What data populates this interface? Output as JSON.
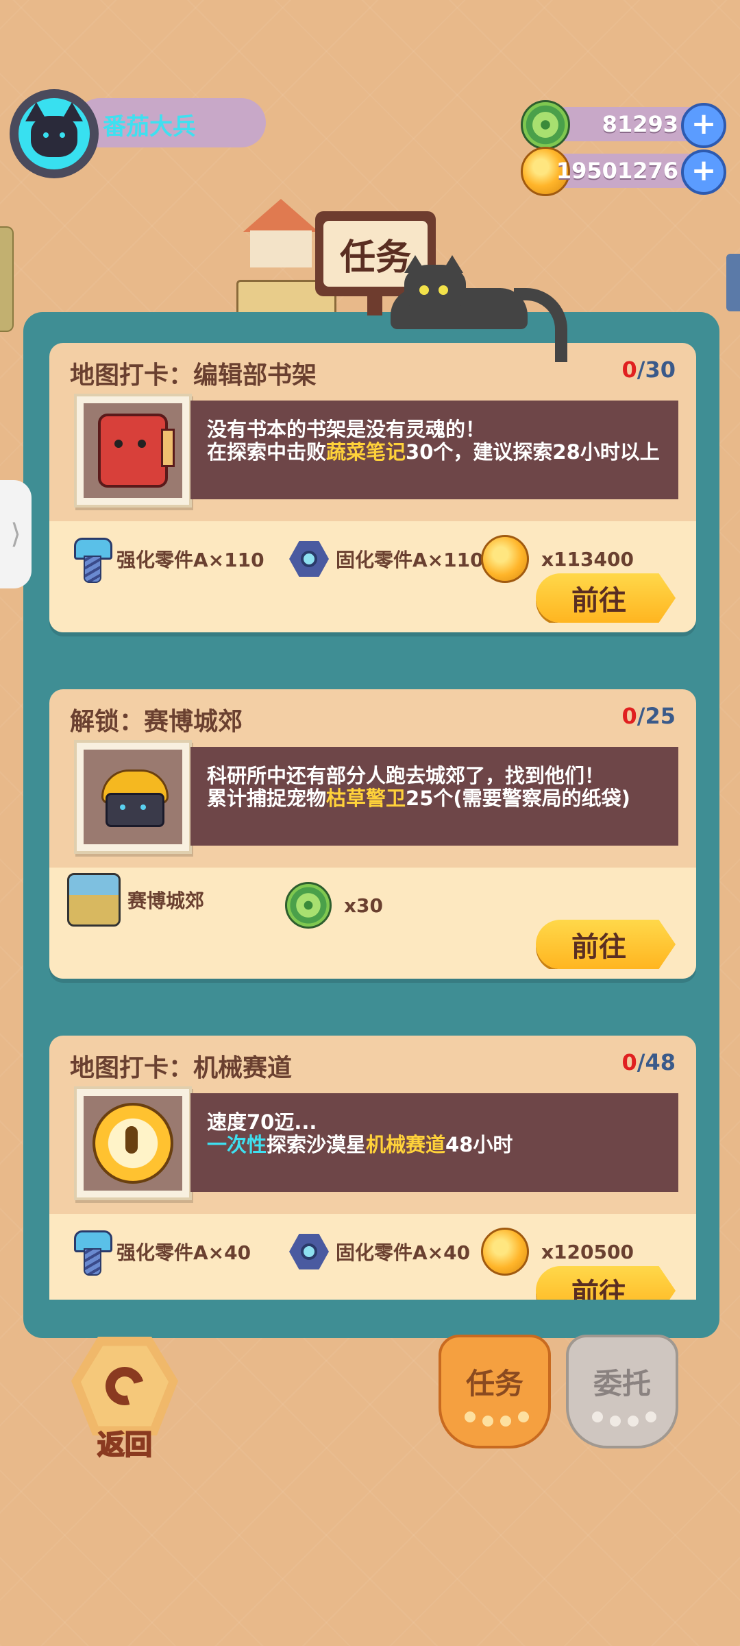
{
  "player": {
    "name": "番茄大兵"
  },
  "currency": {
    "gems": "81293",
    "coins": "19501276"
  },
  "header": {
    "title": "任务"
  },
  "tasks": [
    {
      "title": "地图打卡：编辑部书架",
      "progress_current": "0",
      "progress_total": "/30",
      "desc_line1": "没有书本的书架是没有灵魂的！",
      "desc_line2_pre": "在探索中击败",
      "desc_line2_hl": "蔬菜笔记",
      "desc_line2_post": "30个，建议探索28小时以上",
      "rewards": [
        "强化零件A×110",
        "固化零件A×110",
        "x113400"
      ],
      "button": "前往"
    },
    {
      "title": "解锁：赛博城郊",
      "progress_current": "0",
      "progress_total": "/25",
      "desc_line1": "科研所中还有部分人跑去城郊了，找到他们！",
      "desc_line2_pre": "累计捕捉宠物",
      "desc_line2_hl": "枯草警卫",
      "desc_line2_post": "25个(需要警察局的纸袋)",
      "rewards": [
        "赛博城郊",
        "x30"
      ],
      "button": "前往"
    },
    {
      "title": "地图打卡：机械赛道",
      "progress_current": "0",
      "progress_total": "/48",
      "desc_line1": "速度70迈...",
      "desc_line2_hl_cyan": "一次性",
      "desc_line2_pre": "探索沙漠星",
      "desc_line2_hl": "机械赛道",
      "desc_line2_post": "48小时",
      "rewards": [
        "强化零件A×40",
        "固化零件A×40",
        "x120500"
      ],
      "button": "前往"
    }
  ],
  "bottom": {
    "back": "返回",
    "tab_task": "任务",
    "tab_entrust": "委托"
  },
  "colors": {
    "background": "#e8b98a",
    "panel": "#3f8e94",
    "button": "#ffc530",
    "highlight": "#ffd23a"
  },
  "icons": [
    "avatar-cat-icon",
    "green-gem-icon",
    "gold-coin-icon",
    "plus-icon",
    "screw-icon",
    "nut-icon",
    "undo-icon",
    "paw-icon"
  ]
}
